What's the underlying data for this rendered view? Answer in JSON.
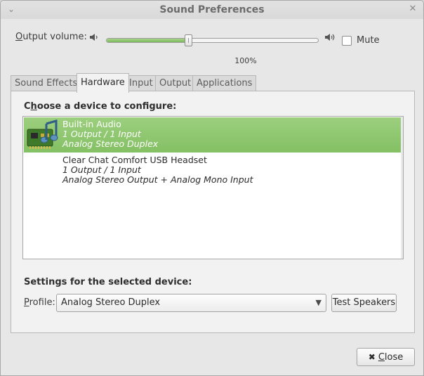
{
  "window": {
    "title": "Sound Preferences"
  },
  "volume": {
    "label_underline": "O",
    "label_rest": "utput volume:",
    "percent_text": "100%",
    "level": 0.39
  },
  "mute": {
    "label": "Mute",
    "checked": false
  },
  "tabs": [
    {
      "label": "Sound Effects",
      "active": false
    },
    {
      "label": "Hardware",
      "active": true
    },
    {
      "label": "Input",
      "active": false
    },
    {
      "label": "Output",
      "active": false
    },
    {
      "label": "Applications",
      "active": false
    }
  ],
  "hardware": {
    "choose_prefix": "C",
    "choose_underline": "h",
    "choose_rest": "oose a device to configure:",
    "devices": [
      {
        "name": "Built-in Audio",
        "io": "1 Output / 1 Input",
        "profile": "Analog Stereo Duplex",
        "selected": true,
        "icon": "sound-card-icon"
      },
      {
        "name": "Clear Chat Comfort USB Headset",
        "io": "1 Output / 1 Input",
        "profile": "Analog Stereo Output + Analog Mono Input",
        "selected": false,
        "icon": ""
      }
    ],
    "settings_label": "Settings for the selected device:",
    "profile_label_underline": "P",
    "profile_label_rest": "rofile:",
    "profile_value": "Analog Stereo Duplex",
    "test_button": "Test Speakers"
  },
  "close_button": {
    "icon": "close-x-icon",
    "underline": "C",
    "rest": "lose"
  },
  "colors": {
    "selection": "#8ec66f",
    "slider_fill": "#90c670"
  }
}
